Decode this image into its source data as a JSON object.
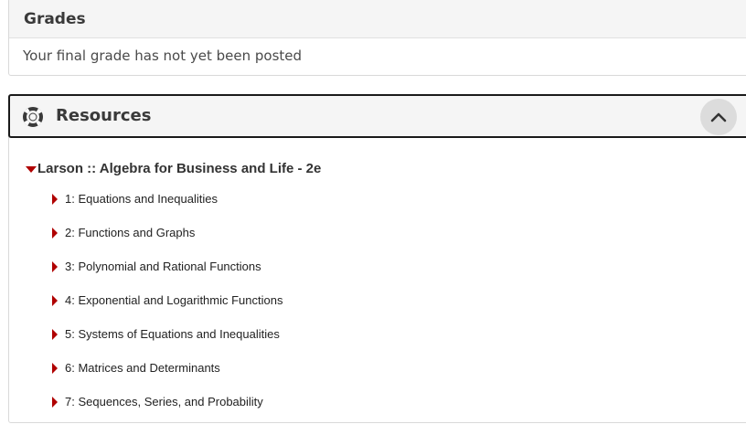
{
  "grades": {
    "title": "Grades",
    "message": "Your final grade has not yet been posted"
  },
  "resources": {
    "title": "Resources",
    "icon": "lifebuoy-icon",
    "collapse_icon": "chevron-up-icon",
    "book": {
      "title": "Larson :: Algebra for Business and Life - 2e",
      "chapters": [
        {
          "label": "1: Equations and Inequalities"
        },
        {
          "label": "2: Functions and Graphs"
        },
        {
          "label": "3: Polynomial and Rational Functions"
        },
        {
          "label": "4: Exponential and Logarithmic Functions"
        },
        {
          "label": "5: Systems of Equations and Inequalities"
        },
        {
          "label": "6: Matrices and Determinants"
        },
        {
          "label": "7: Sequences, Series, and Probability"
        }
      ]
    }
  },
  "colors": {
    "accent": "#b00000",
    "header_bg": "#f5f5f5",
    "button_bg": "#dcdcdc"
  }
}
